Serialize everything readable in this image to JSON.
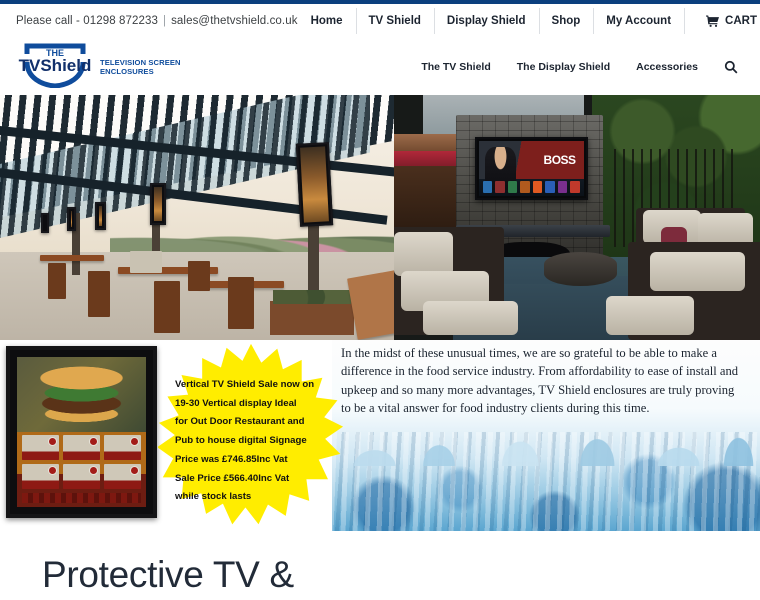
{
  "theme": {
    "accent_bar": "#0b3f7e",
    "brand_blue": "#0f4c9c",
    "text_dark": "#1c2430",
    "promo_yellow": "#ffed00"
  },
  "topbar": {
    "contact_prefix": "Please call - 01298 872233",
    "separator": "|",
    "email": "sales@thetvshield.co.uk",
    "nav": [
      {
        "label": "Home"
      },
      {
        "label": "TV Shield"
      },
      {
        "label": "Display Shield"
      },
      {
        "label": "Shop"
      },
      {
        "label": "My Account"
      }
    ],
    "cart_label": "CART",
    "cart_icon": "shopping-cart-icon",
    "cart_chevron": "chevron-down-icon"
  },
  "header": {
    "logo": {
      "the": "THE",
      "tv": "TV",
      "shield": "Shield",
      "tagline_line1": "TELEVISION SCREEN",
      "tagline_line2": "ENCLOSURES"
    },
    "nav": [
      {
        "label": "The TV Shield"
      },
      {
        "label": "The Display Shield"
      },
      {
        "label": "Accessories"
      }
    ],
    "search_icon": "search-icon"
  },
  "hero": {
    "left_alt": "outdoor restaurant patio with pergola and vertical digital menu displays",
    "right_alt": "outdoor patio lounge with stone fireplace and weatherproof TV enclosure",
    "tv_screen_label": "BOSS"
  },
  "promo": {
    "product_alt": "vertical digital menu board in black TV Shield enclosure showing burger menu",
    "burst_lines": [
      "Vertical TV Shield Sale now on",
      "19-30 Vertical display Ideal",
      "for Out Door Restaurant and",
      "Pub to house digital Signage",
      "Price was £746.85Inc Vat",
      "Sale Price £566.40Inc Vat",
      "while stock lasts"
    ],
    "paragraph": "In the midst of these unusual times, we are so grateful to be able to make a difference in the food service industry. From affordability to ease of install and upkeep and so many more advantages, TV Shield enclosures are truly proving to be a vital answer for food industry clients during this time."
  },
  "below_fold": {
    "heading": "Protective TV &"
  }
}
